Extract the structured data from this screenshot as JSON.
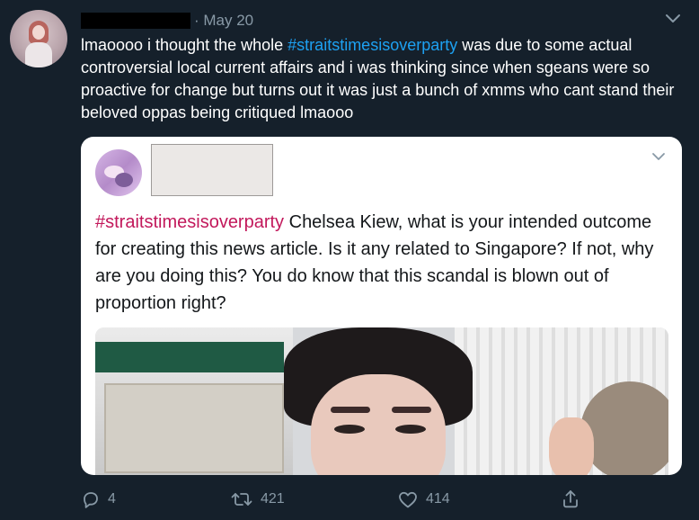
{
  "tweet": {
    "date": "· May 20",
    "text_before": "lmaoooo i thought the whole ",
    "hashtag": "#straitstimesisoverparty",
    "text_after": " was due to some actual controversial local current affairs and i was thinking since when sgeans were so proactive for change but turns out it was just a bunch of xmms who cant stand their beloved oppas being critiqued lmaooo",
    "chevron_icon": "chevron-down-icon"
  },
  "quoted": {
    "hashtag": "#straitstimesisoverparty",
    "text": " Chelsea Kiew, what is your intended outcome for creating this news article. Is it any related to Singapore? If not, why are you doing this? You do know that this scandal is blown out of proportion right?",
    "chevron_icon": "chevron-down-icon"
  },
  "actions": {
    "reply_count": "4",
    "retweet_count": "421",
    "like_count": "414",
    "reply_icon": "reply-icon",
    "retweet_icon": "retweet-icon",
    "like_icon": "heart-icon",
    "share_icon": "share-icon"
  },
  "colors": {
    "background": "#15202b",
    "text": "#ffffff",
    "muted": "#8899a6",
    "hashtag": "#1da1f2",
    "quoted_hashtag": "#c2185b"
  }
}
